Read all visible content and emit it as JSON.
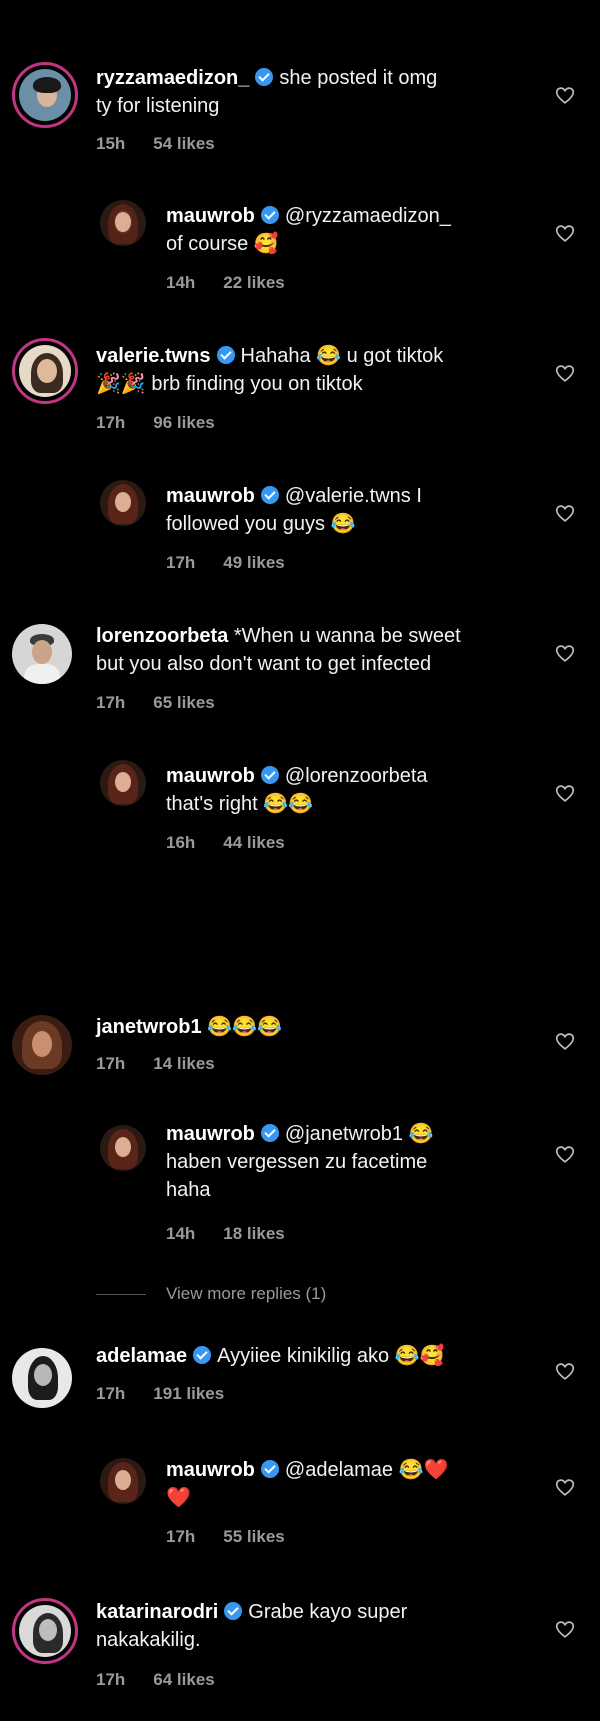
{
  "comments": [
    {
      "username": "ryzzamaedizon_",
      "verified": true,
      "text_line1": "she posted it omg",
      "text_line2": "ty for listening",
      "time": "15h",
      "likes": "54 likes"
    },
    {
      "username": "mauwrob",
      "verified": true,
      "text_line1": "@ryzzamaedizon_",
      "text_line2": "of course 🥰",
      "time": "14h",
      "likes": "22 likes"
    },
    {
      "username": "valerie.twns",
      "verified": true,
      "text_line1": "Hahaha 😂 u got tiktok",
      "text_line2": "🎉🎉 brb finding you on tiktok",
      "time": "17h",
      "likes": "96 likes"
    },
    {
      "username": "mauwrob",
      "verified": true,
      "text_line1": "@valerie.twns I",
      "text_line2": "followed you guys 😂",
      "time": "17h",
      "likes": "49 likes"
    },
    {
      "username": "lorenzoorbeta",
      "verified": false,
      "text_line1": "*When u wanna be sweet",
      "text_line2": "but you also don't want to get infected",
      "time": "17h",
      "likes": "65 likes"
    },
    {
      "username": "mauwrob",
      "verified": true,
      "text_line1": "@lorenzoorbeta",
      "text_line2": "that's right 😂😂",
      "time": "16h",
      "likes": "44 likes"
    },
    {
      "username": "janetwrob1",
      "verified": false,
      "text_line1": "😂😂😂",
      "text_line2": "",
      "time": "17h",
      "likes": "14 likes"
    },
    {
      "username": "mauwrob",
      "verified": true,
      "text_line1": "@janetwrob1 😂",
      "text_line2": "haben vergessen zu facetime",
      "text_line3": "haha",
      "time": "14h",
      "likes": "18 likes"
    },
    {
      "username": "adelamae",
      "verified": true,
      "text_line1": "Ayyiiee kinikilig ako 😂🥰",
      "text_line2": "",
      "time": "17h",
      "likes": "191 likes"
    },
    {
      "username": "mauwrob",
      "verified": true,
      "text_line1": "@adelamae 😂❤️",
      "text_line2": "❤️",
      "time": "17h",
      "likes": "55 likes"
    },
    {
      "username": "katarinarodri",
      "verified": true,
      "text_line1": "Grabe kayo super",
      "text_line2": "nakakakilig.",
      "time": "17h",
      "likes": "64 likes"
    }
  ],
  "view_more": "View more replies (1)",
  "colors": {
    "background": "#000000",
    "text": "#f2f2f2",
    "meta": "#9a9a9a",
    "verified": "#3897f0",
    "story_ring": "#c13584"
  },
  "icons": {
    "verified": "verified-badge-icon",
    "like": "heart-outline-icon"
  }
}
